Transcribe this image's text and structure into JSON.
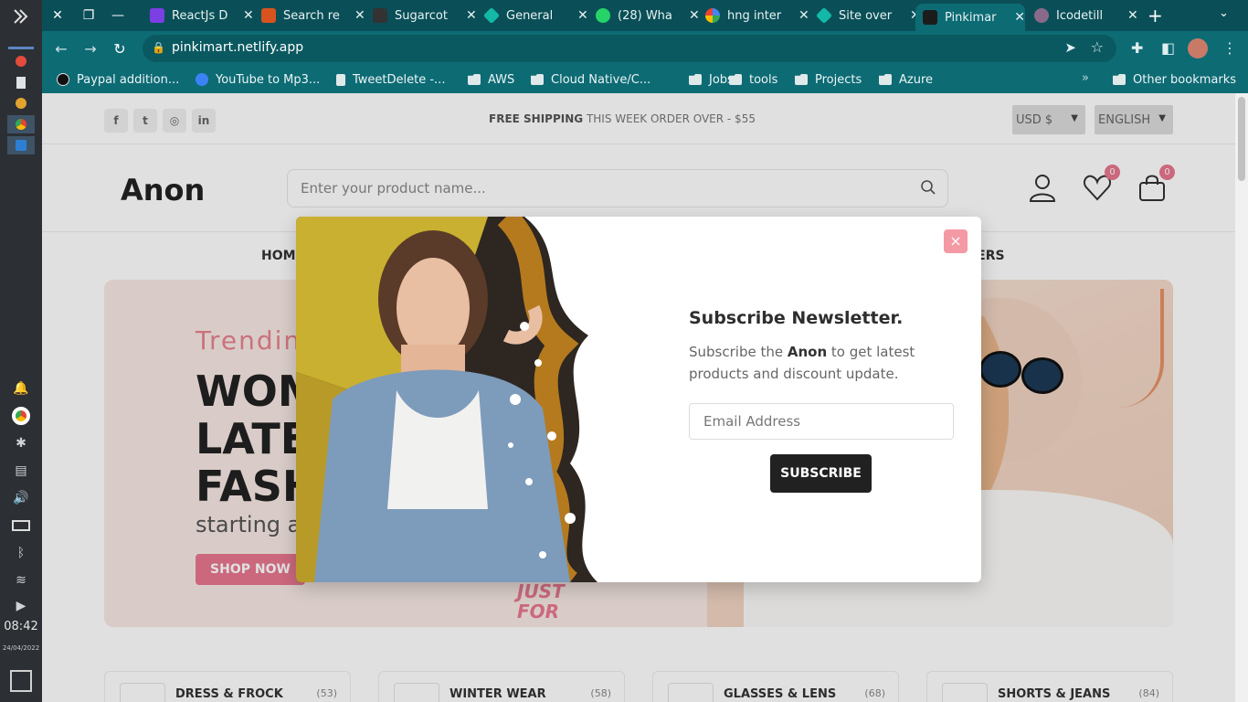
{
  "os": {
    "time": "08:42",
    "date": "24/04/2022"
  },
  "browser": {
    "tabs": [
      {
        "title": "ReactJs D",
        "color": "#7b3fe4"
      },
      {
        "title": "Search re",
        "color": "#d9531e"
      },
      {
        "title": "Sugarcot",
        "color": "#333333"
      },
      {
        "title": "General",
        "color": "#14b8a6"
      },
      {
        "title": "(28) Wha",
        "color": "#25d366"
      },
      {
        "title": "hng inter",
        "color": "#ffffff"
      },
      {
        "title": "Site over",
        "color": "#14b8a6"
      },
      {
        "title": "Pinkimar",
        "color": "#1c1c1c"
      },
      {
        "title": "Icodetill",
        "color": "#8a6a8a"
      }
    ],
    "url": "pinkimart.netlify.app",
    "bookmarks": [
      {
        "label": "Paypal addition...",
        "icon": "github-icon"
      },
      {
        "label": "YouTube to Mp3...",
        "icon": "info-icon"
      },
      {
        "label": "TweetDelete -...",
        "icon": "trash-icon"
      },
      {
        "label": "AWS",
        "icon": "folder-icon"
      },
      {
        "label": "Cloud Native/C...",
        "icon": "folder-icon"
      },
      {
        "label": "Jobs",
        "icon": "folder-icon"
      },
      {
        "label": "tools",
        "icon": "folder-icon"
      },
      {
        "label": "Projects",
        "icon": "folder-icon"
      },
      {
        "label": "Azure",
        "icon": "folder-icon"
      }
    ],
    "other_bookmarks": "Other bookmarks",
    "more": "»"
  },
  "site": {
    "shipping_bold": "FREE SHIPPING",
    "shipping_rest": "THIS WEEK ORDER OVER - $55",
    "currency": "USD $",
    "language": "ENGLISH",
    "logo": "Anon",
    "search_placeholder": "Enter your product name...",
    "wishlist_count": "0",
    "cart_count": "0",
    "nav_home": "HOME",
    "nav_offers": "FFERS",
    "hero_sub": "Trendin",
    "hero_title_1": "WOM",
    "hero_title_2": "LATES",
    "hero_title_3": "FASH",
    "hero_start": "starting a",
    "hero_button": "SHOP NOW",
    "hero_justfor_1": "JUST",
    "hero_justfor_2": "FOR",
    "categories": [
      {
        "name": "DRESS & FROCK",
        "count": "(53)"
      },
      {
        "name": "WINTER WEAR",
        "count": "(58)"
      },
      {
        "name": "GLASSES & LENS",
        "count": "(68)"
      },
      {
        "name": "SHORTS & JEANS",
        "count": "(84)"
      }
    ]
  },
  "modal": {
    "heading": "Subscribe Newsletter.",
    "text_pre": "Subscribe the ",
    "text_brand": "Anon",
    "text_post": " to get latest products and discount update.",
    "email_placeholder": "Email Address",
    "button": "SUBSCRIBE",
    "close": "×"
  },
  "colors": {
    "accent": "#e8778f",
    "browser": "#0d6b74"
  }
}
